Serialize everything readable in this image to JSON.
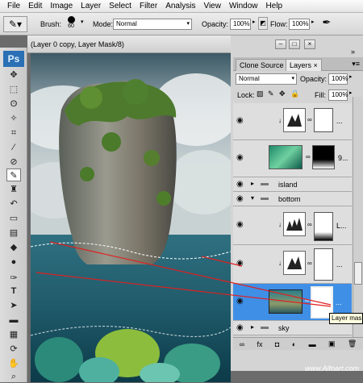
{
  "menu": [
    "File",
    "Edit",
    "Image",
    "Layer",
    "Select",
    "Filter",
    "Analysis",
    "View",
    "Window",
    "Help"
  ],
  "options": {
    "brush_label": "Brush:",
    "brush_size": "60",
    "mode_label": "Mode:",
    "mode_value": "Normal",
    "opacity_label": "Opacity:",
    "opacity_value": "100%",
    "flow_label": "Flow:",
    "flow_value": "100%"
  },
  "toolbox": {
    "logo": "Ps"
  },
  "document": {
    "title": "(Layer 0 copy, Layer Mask/8)"
  },
  "panel": {
    "tabs": [
      "Clone Source",
      "Layers"
    ],
    "tab_close": "×",
    "blend_mode": "Normal",
    "opacity_label": "Opacity:",
    "opacity_value": "100%",
    "lock_label": "Lock:",
    "fill_label": "Fill:",
    "fill_value": "100%",
    "layers": {
      "row1_dots": "...",
      "row2_name": "9...",
      "island": "island",
      "bottom": "bottom",
      "row5_name": "L...",
      "row6_dots": "...",
      "row7_dots": "...",
      "sky": "sky"
    },
    "tooltip": "Layer mas"
  },
  "watermark": "www.Alfoart.com",
  "colors": {
    "selection": "#3f8fe6",
    "annotation": "#e02020"
  }
}
